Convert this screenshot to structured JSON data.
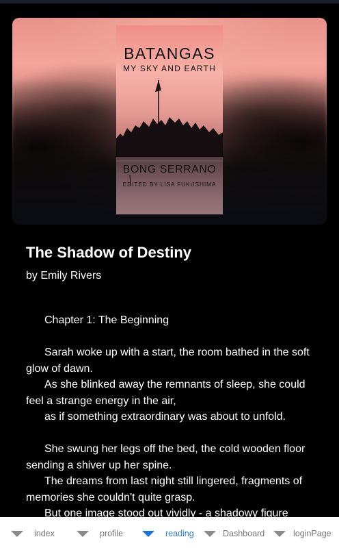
{
  "book": {
    "cover": {
      "title": "BATANGAS",
      "subtitle": "MY SKY AND EARTH",
      "author": "BONG SERRANO",
      "editor": "EDITED BY LISA FUKUSHIMA"
    },
    "title": "The Shadow of Destiny",
    "byline": "by Emily Rivers"
  },
  "content": {
    "chapter": "Chapter 1: The Beginning",
    "p1a": "Sarah woke up with a start, the room bathed in the soft glow of dawn.",
    "p1b": "As she blinked away the remnants of sleep, she could feel a strange energy in the air,",
    "p1c": "as if something extraordinary was about to unfold.",
    "p2a": "She swung her legs off the bed, the cold wooden floor sending a shiver up her spine.",
    "p2b": "The dreams from last night still lingered, fragments of memories she couldn't quite grasp.",
    "p2c": "But one image stood out vividly - a shadowy figure"
  },
  "nav": {
    "items": [
      {
        "label": "index"
      },
      {
        "label": "profile"
      },
      {
        "label": "reading"
      },
      {
        "label": "Dashboard"
      },
      {
        "label": "loginPage"
      }
    ],
    "active": "reading",
    "colors": {
      "active": "#1e6fe0",
      "inactive": "#8a8a8a"
    }
  },
  "icons": {
    "nav": "caret-down-icon"
  }
}
